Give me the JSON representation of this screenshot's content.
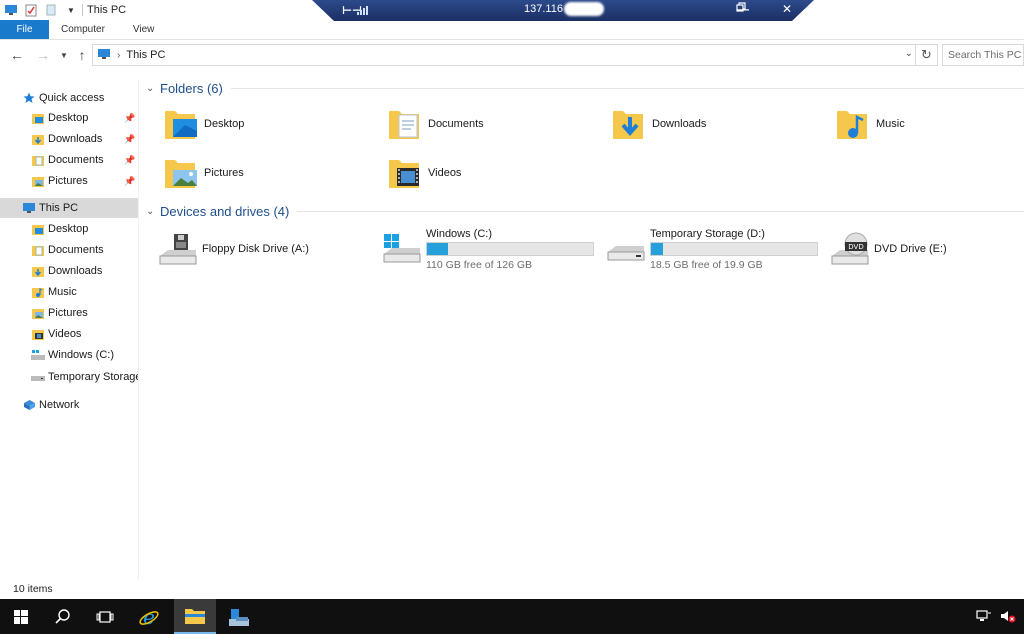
{
  "window": {
    "title": "This PC"
  },
  "rdp": {
    "ip": "137.116"
  },
  "ribbon": {
    "tabs": [
      "File",
      "Computer",
      "View"
    ]
  },
  "address": {
    "path": "This PC",
    "search_placeholder": "Search This PC"
  },
  "sidebar": {
    "quick_access": "Quick access",
    "quick_items": [
      {
        "label": "Desktop",
        "icon": "desktop-folder-icon"
      },
      {
        "label": "Downloads",
        "icon": "downloads-folder-icon"
      },
      {
        "label": "Documents",
        "icon": "documents-folder-icon"
      },
      {
        "label": "Pictures",
        "icon": "pictures-folder-icon"
      }
    ],
    "this_pc": "This PC",
    "pc_items": [
      {
        "label": "Desktop",
        "icon": "desktop-folder-icon"
      },
      {
        "label": "Documents",
        "icon": "documents-folder-icon"
      },
      {
        "label": "Downloads",
        "icon": "downloads-folder-icon"
      },
      {
        "label": "Music",
        "icon": "music-folder-icon"
      },
      {
        "label": "Pictures",
        "icon": "pictures-folder-icon"
      },
      {
        "label": "Videos",
        "icon": "videos-folder-icon"
      },
      {
        "label": "Windows (C:)",
        "icon": "windows-drive-icon"
      },
      {
        "label": "Temporary Storage (",
        "icon": "drive-icon"
      }
    ],
    "network": "Network"
  },
  "main": {
    "folders_header": "Folders (6)",
    "folders": [
      {
        "label": "Desktop",
        "icon": "desktop-folder-icon"
      },
      {
        "label": "Documents",
        "icon": "documents-folder-icon"
      },
      {
        "label": "Downloads",
        "icon": "downloads-folder-icon"
      },
      {
        "label": "Music",
        "icon": "music-folder-icon"
      },
      {
        "label": "Pictures",
        "icon": "pictures-folder-icon"
      },
      {
        "label": "Videos",
        "icon": "videos-folder-icon"
      }
    ],
    "drives_header": "Devices and drives (4)",
    "drives": [
      {
        "label": "Floppy Disk Drive (A:)",
        "icon": "floppy-drive-icon"
      },
      {
        "label": "Windows (C:)",
        "icon": "windows-drive-icon",
        "free": "110 GB free of 126 GB",
        "used_fraction": 0.127
      },
      {
        "label": "Temporary Storage (D:)",
        "icon": "drive-icon",
        "free": "18.5 GB free of 19.9 GB",
        "used_fraction": 0.07
      },
      {
        "label": "DVD Drive (E:)",
        "icon": "dvd-drive-icon"
      }
    ]
  },
  "status": {
    "items": "10 items"
  },
  "colors": {
    "accent": "#1979ca",
    "drive_fill": "#26a0da",
    "folder": "#f5c84c",
    "taskbar": "#101010"
  }
}
